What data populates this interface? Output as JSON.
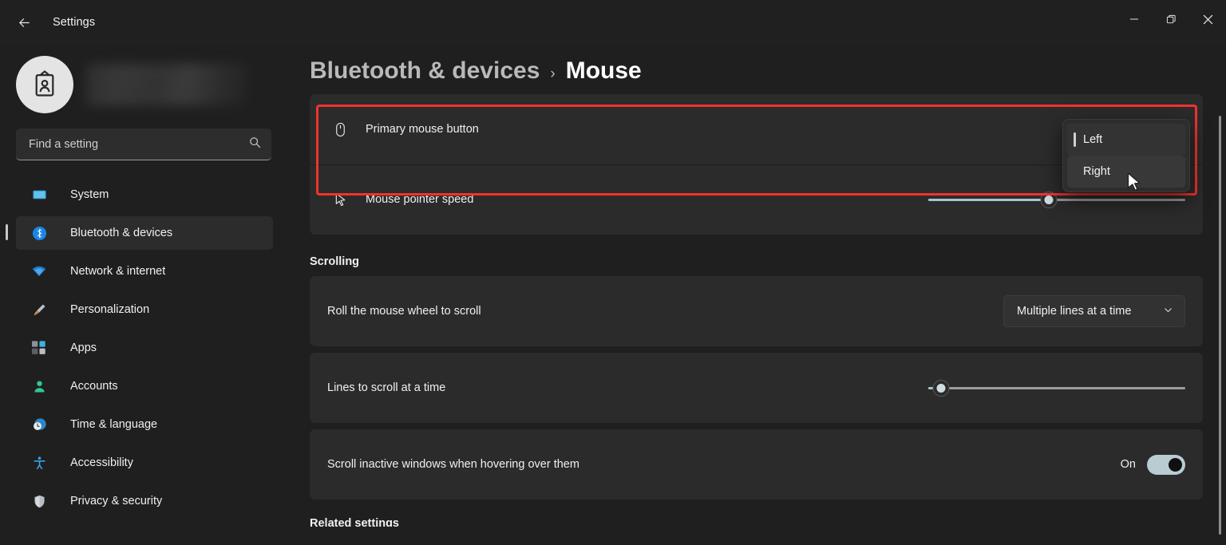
{
  "window": {
    "app_title": "Settings",
    "back_icon": "back-arrow-icon",
    "controls": {
      "minimize": "minimize-icon",
      "restore": "restore-icon",
      "close": "close-icon"
    }
  },
  "sidebar": {
    "account": {
      "avatar_icon": "badge-person-icon",
      "name_redacted": ""
    },
    "search": {
      "placeholder": "Find a setting",
      "value": "",
      "icon": "search-icon"
    },
    "items": [
      {
        "label": "System",
        "icon": "monitor-icon",
        "color": "#3fa9e0",
        "selected": false
      },
      {
        "label": "Bluetooth & devices",
        "icon": "bluetooth-icon",
        "color": "#1a86e8",
        "selected": true
      },
      {
        "label": "Network & internet",
        "icon": "wifi-icon",
        "color": "#1e7ad0",
        "selected": false
      },
      {
        "label": "Personalization",
        "icon": "brush-icon",
        "color": "#d98b3a",
        "selected": false
      },
      {
        "label": "Apps",
        "icon": "apps-icon",
        "color": "#2fa3dd",
        "selected": false
      },
      {
        "label": "Accounts",
        "icon": "person-icon",
        "color": "#2fc79a",
        "selected": false
      },
      {
        "label": "Time & language",
        "icon": "clock-icon",
        "color": "#2f86c7",
        "selected": false
      },
      {
        "label": "Accessibility",
        "icon": "accessibility-icon",
        "color": "#3aa0e8",
        "selected": false
      },
      {
        "label": "Privacy & security",
        "icon": "shield-icon",
        "color": "#b8bdc2",
        "selected": false
      }
    ]
  },
  "main": {
    "breadcrumb": {
      "parent": "Bluetooth & devices",
      "separator": "›",
      "current": "Mouse"
    },
    "mouse_card": {
      "primary_button": {
        "label": "Primary mouse button",
        "icon": "mouse-icon",
        "value": "Left"
      },
      "pointer_speed": {
        "label": "Mouse pointer speed",
        "icon": "cursor-arrow-icon",
        "percent": 47
      }
    },
    "dropdown_open": {
      "options": [
        {
          "label": "Left",
          "selected": true,
          "hovered": false
        },
        {
          "label": "Right",
          "selected": false,
          "hovered": true
        }
      ]
    },
    "scrolling": {
      "section_title": "Scrolling",
      "wheel": {
        "label": "Roll the mouse wheel to scroll",
        "value": "Multiple lines at a time",
        "chevron_icon": "chevron-down-icon"
      },
      "lines": {
        "label": "Lines to scroll at a time",
        "percent": 5
      },
      "inactive": {
        "label": "Scroll inactive windows when hovering over them",
        "state": "On",
        "on": true
      }
    },
    "related_settings_title": "Related settings"
  },
  "annotation": {
    "highlight_color": "#f0332f",
    "cursor_icon": "mouse-pointer-icon"
  }
}
